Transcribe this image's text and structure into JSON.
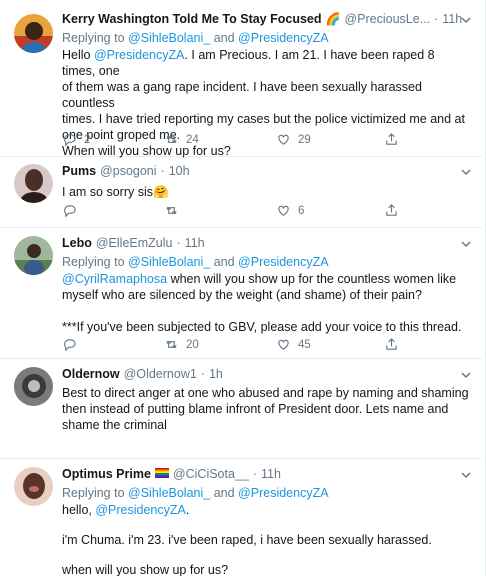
{
  "tweets": [
    {
      "name": "Kerry Washington Told Me To Stay Focused",
      "name_emoji": "🌈",
      "handle": "@PreciousLe...",
      "time": "11h",
      "reply_prefix": "Replying to",
      "reply_to_1": "@SihleBolani_",
      "reply_and": "and",
      "reply_to_2": "@PresidencyZA",
      "lines": [
        "Hello @PresidencyZA. I am Precious. I am 21. I have been raped 8 times, one",
        "of them was a gang rape incident. I have been sexually harassed countless",
        "times. I have tried reporting my cases but the police victimized me and at",
        "one point groped me.",
        "When will you show up for us?"
      ],
      "mention_word": "@PresidencyZA",
      "replies": "2",
      "retweets": "24",
      "likes": "29"
    },
    {
      "name": "Pums",
      "handle": "@psogoni",
      "time": "10h",
      "text": "I am so sorry sis",
      "text_emoji": "🤗",
      "replies": "",
      "retweets": "",
      "likes": "6"
    },
    {
      "name": "Lebo",
      "handle": "@ElleEmZulu",
      "time": "11h",
      "reply_prefix": "Replying to",
      "reply_to_1": "@SihleBolani_",
      "reply_and": "and",
      "reply_to_2": "@PresidencyZA",
      "mention": "@CyrilRamaphosa",
      "line1_rest": " when will you show up for the countless women like",
      "line2": "myself who are silenced by the weight (and shame) of their pain?",
      "line3": "***If you've been subjected to GBV, please add your voice to this thread.",
      "replies": "",
      "retweets": "20",
      "likes": "45"
    },
    {
      "name": "Oldernow",
      "handle": "@Oldernow1",
      "time": "1h",
      "lines": [
        "Best to direct anger at one who abused and rape by naming and shaming",
        "then instead of putting blame infront of President door. Lets name and",
        "shame the criminal"
      ],
      "replies": "",
      "retweets": "",
      "likes": ""
    },
    {
      "name": "Optimus Prime",
      "handle": "@CiCiSota__",
      "time": "11h",
      "reply_prefix": "Replying to",
      "reply_to_1": "@SihleBolani_",
      "reply_and": "and",
      "reply_to_2": "@PresidencyZA",
      "line1_pre": "hello, ",
      "mention": "@PresidencyZA",
      "line1_post": ".",
      "line2": "i'm Chuma. i'm 23. i've been raped, i have been sexually harassed.",
      "line3": "when will you show up for us?"
    }
  ],
  "colors": {
    "link": "#1b95e0",
    "muted": "#657786",
    "divider": "#e6ecf0"
  },
  "icons": [
    "reply-icon",
    "retweet-icon",
    "like-icon",
    "share-icon",
    "caret-down-icon"
  ]
}
